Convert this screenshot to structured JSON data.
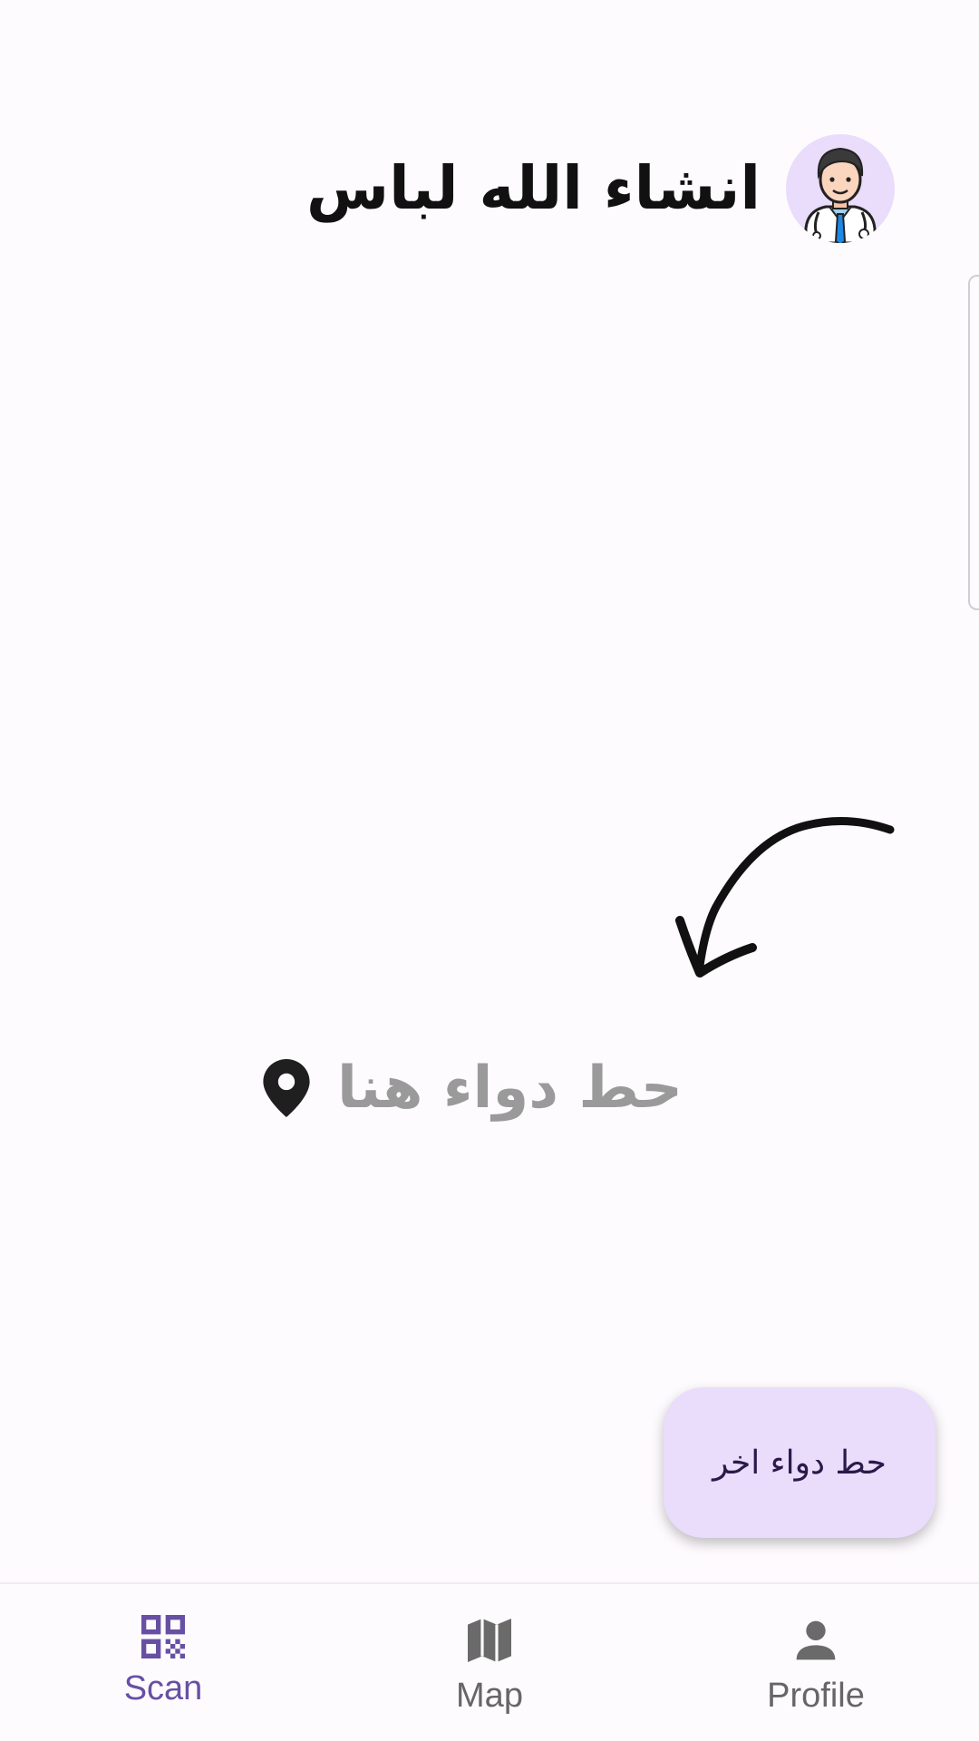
{
  "header": {
    "user_name": "انشاء الله لباس",
    "avatar_icon": "doctor-avatar-icon"
  },
  "hint": {
    "text": "حط دواء هنا",
    "icon": "location-pin-icon",
    "arrow_icon": "curved-arrow-icon"
  },
  "fab": {
    "label": "حط دواء اخر"
  },
  "bottom_nav": {
    "items": [
      {
        "label": "Scan",
        "icon": "qr-code-icon",
        "active": true
      },
      {
        "label": "Map",
        "icon": "map-icon",
        "active": false
      },
      {
        "label": "Profile",
        "icon": "person-icon",
        "active": false
      }
    ]
  },
  "colors": {
    "background": "#fefbfe",
    "accent": "#6750a4",
    "fab_background": "#eadcfb",
    "hint_text": "#9a9a9a"
  }
}
